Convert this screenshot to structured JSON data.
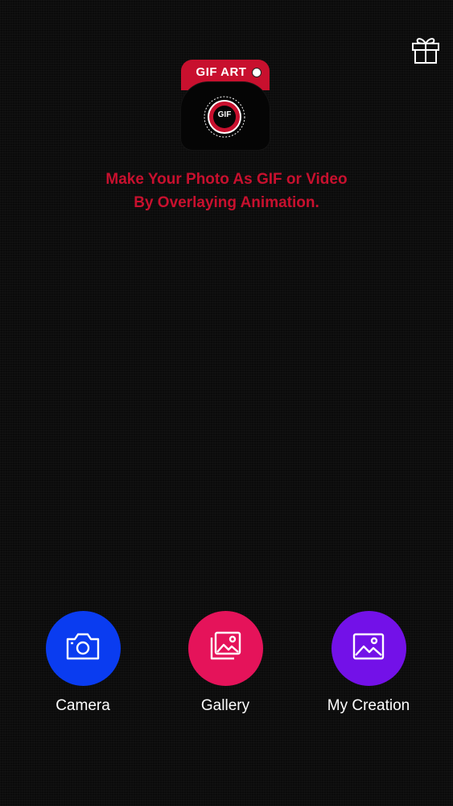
{
  "logo": {
    "title": "GIF ART",
    "badge_text": "GIF"
  },
  "tagline": {
    "line1": "Make Your Photo As GIF or Video",
    "line2": "By Overlaying Animation."
  },
  "actions": [
    {
      "label": "Camera",
      "icon": "camera-icon",
      "color": "#0a3cf0"
    },
    {
      "label": "Gallery",
      "icon": "gallery-icon",
      "color": "#e5135a"
    },
    {
      "label": "My Creation",
      "icon": "image-icon",
      "color": "#7311e8"
    }
  ],
  "colors": {
    "accent": "#c8102e",
    "background": "#0b0b0b"
  },
  "top_right_icon": "gift-icon"
}
